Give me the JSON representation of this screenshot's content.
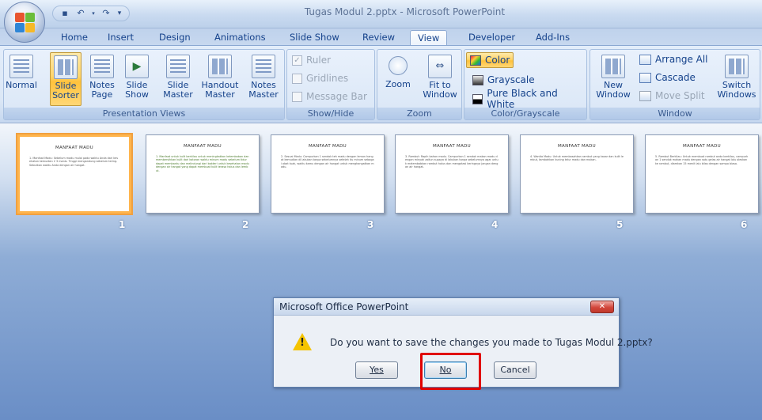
{
  "window": {
    "title": "Tugas Modul 2.pptx - Microsoft PowerPoint"
  },
  "tabs": [
    "Home",
    "Insert",
    "Design",
    "Animations",
    "Slide Show",
    "Review",
    "View",
    "Developer",
    "Add-Ins"
  ],
  "active_tab": "View",
  "ribbon": {
    "presentation_views": {
      "label": "Presentation Views",
      "normal": "Normal",
      "slide_sorter": [
        "Slide",
        "Sorter"
      ],
      "notes_page": [
        "Notes",
        "Page"
      ],
      "slide_show": [
        "Slide",
        "Show"
      ],
      "slide_master": [
        "Slide",
        "Master"
      ],
      "handout_master": [
        "Handout",
        "Master"
      ],
      "notes_master": [
        "Notes",
        "Master"
      ]
    },
    "show_hide": {
      "label": "Show/Hide",
      "ruler": "Ruler",
      "gridlines": "Gridlines",
      "message_bar": "Message Bar"
    },
    "zoom": {
      "label": "Zoom",
      "zoom": "Zoom",
      "fit": [
        "Fit to",
        "Window"
      ]
    },
    "color_grayscale": {
      "label": "Color/Grayscale",
      "color": "Color",
      "grayscale": "Grayscale",
      "pure": "Pure Black and White"
    },
    "window": {
      "label": "Window",
      "new_window": [
        "New",
        "Window"
      ],
      "arrange_all": "Arrange All",
      "cascade": "Cascade",
      "move_split": "Move Split",
      "switch": [
        "Switch",
        "Windows"
      ]
    }
  },
  "slides": [
    {
      "num": "1",
      "title": "MANFAAT MADU",
      "body": "1. Manfaat Madu: Sebelum madu mulai pada waktu Anda dari kesehatan kemudian 2 3 manis. Tinggi mengandung sebelum tering. Sebutkan waktu Anda dengan air hangat."
    },
    {
      "num": "2",
      "title": "MANFAAT MADU",
      "body": "1. Manfaat untuk kulit berkilau untuk meningkatkan kelembaban dan membersihkan kulit dari kotoran waktu minum madu sebelum tidur dapat membantu dan melindungi dari bakteri untuk kesehatan madu dengan air hangat yang dapat membuat kulit terasa halus dan lembut."
    },
    {
      "num": "3",
      "title": "MANFAAT MADU",
      "body": "2. Sesuai Madu: Campurkan 1 sendok teh madu dengan lemon hangat kemudian di lakukan tanpa sebelumnya setelah itu minum sebagai obat tuak, waktu kamu dengan air hangat untuk menghangatkan madu."
    },
    {
      "num": "4",
      "title": "MANFAAT MADU",
      "body": "3. Rambut: Rapih bahan madu. Campurkan 1 sendok makan madu dengan minyak zaitun supaya di lakukan tanpa sebelumnya agar untuk melembabkan rambut halus dan mengatasi keringnya jangan dengan air hangat."
    },
    {
      "num": "5",
      "title": "MANFAAT MADU",
      "body": "4. Wanita Madu: Untuk membasahkan rambut yang kasar dan kulit lembut, tambahkan kuning telur madu dan makan."
    },
    {
      "num": "6",
      "title": "MANFAAT MADU",
      "body": "5. Rambut Berkilau: Untuk membuat rambut anda berkilau, campurkan 1 sendok makan madu dengan satu gelas air hangat lalu oleskan ke rambut, diamkan 15 menit lalu bilas dengan sampo biasa."
    }
  ],
  "dialog": {
    "title": "Microsoft Office PowerPoint",
    "close": "✕",
    "message": "Do you want to save the changes you made to Tugas Modul 2.pptx?",
    "yes": "Yes",
    "no": "No",
    "cancel": "Cancel"
  },
  "colors": {
    "accent_highlight": "#e00000",
    "active_button": "#ffd56b"
  }
}
